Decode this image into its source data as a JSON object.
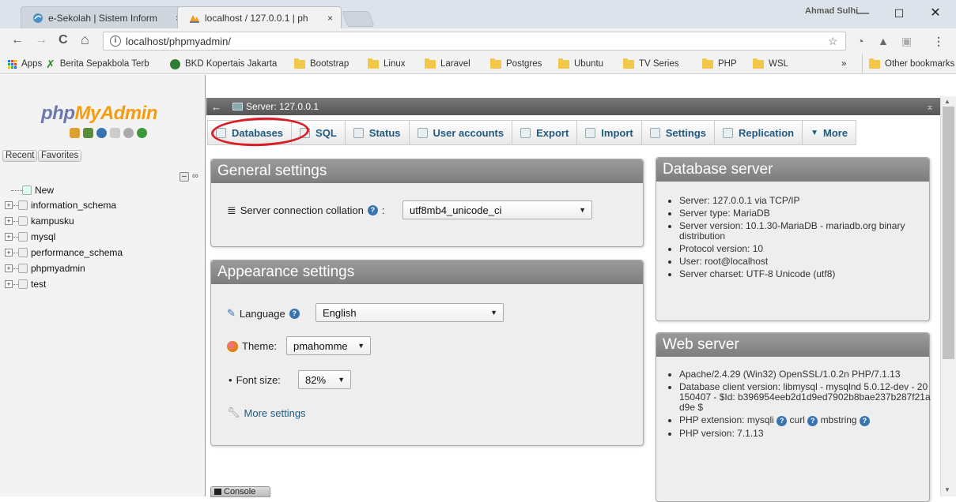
{
  "browser": {
    "tabs": [
      {
        "title": "e-Sekolah | Sistem Inform",
        "close": "×"
      },
      {
        "title": "localhost / 127.0.0.1 | ph",
        "close": "×"
      }
    ],
    "user": "Ahmad Sulhi",
    "window_controls": {
      "minimize": "—",
      "maximize": "☐",
      "close": "✕"
    },
    "url": "localhost/phpmyadmin/",
    "nav": {
      "back": "←",
      "forward": "→",
      "reload": "C",
      "home": "⌂"
    },
    "bookmarks": [
      {
        "label": "Apps",
        "icon": "apps-grid-icon"
      },
      {
        "label": "Berita Sepakbola Terb",
        "icon": "site-icon"
      },
      {
        "label": "BKD Kopertais Jakarta",
        "icon": "site-icon"
      },
      {
        "label": "Bootstrap",
        "icon": "folder-icon"
      },
      {
        "label": "Linux",
        "icon": "folder-icon"
      },
      {
        "label": "Laravel",
        "icon": "folder-icon"
      },
      {
        "label": "Postgres",
        "icon": "folder-icon"
      },
      {
        "label": "Ubuntu",
        "icon": "folder-icon"
      },
      {
        "label": "TV Series",
        "icon": "folder-icon"
      },
      {
        "label": "PHP",
        "icon": "folder-icon"
      },
      {
        "label": "WSL",
        "icon": "folder-icon"
      }
    ],
    "more_bookmarks": "»",
    "other_bookmarks": "Other bookmarks"
  },
  "sidebar": {
    "logo_php": "php",
    "logo_myadmin": "MyAdmin",
    "recent": "Recent",
    "favorites": "Favorites",
    "tree": [
      {
        "label": "New",
        "type": "new"
      },
      {
        "label": "information_schema",
        "type": "db"
      },
      {
        "label": "kampusku",
        "type": "db"
      },
      {
        "label": "mysql",
        "type": "db"
      },
      {
        "label": "performance_schema",
        "type": "db"
      },
      {
        "label": "phpmyadmin",
        "type": "db"
      },
      {
        "label": "test",
        "type": "db"
      }
    ]
  },
  "server_bar": {
    "label": "Server: 127.0.0.1",
    "back": "←",
    "collapse": "⌅"
  },
  "menu": [
    {
      "label": "Databases"
    },
    {
      "label": "SQL"
    },
    {
      "label": "Status"
    },
    {
      "label": "User accounts"
    },
    {
      "label": "Export"
    },
    {
      "label": "Import"
    },
    {
      "label": "Settings"
    },
    {
      "label": "Replication"
    },
    {
      "label": "More",
      "prefix": "▼"
    }
  ],
  "general_settings": {
    "title": "General settings",
    "collation_label": "Server connection collation",
    "collation_colon": ":",
    "collation_value": "utf8mb4_unicode_ci"
  },
  "appearance_settings": {
    "title": "Appearance settings",
    "language_label": "Language",
    "language_value": "English",
    "theme_label": "Theme:",
    "theme_value": "pmahomme",
    "font_size_label": "Font size:",
    "font_size_value": "82%",
    "more_settings": "More settings"
  },
  "database_server": {
    "title": "Database server",
    "items": [
      "Server: 127.0.0.1 via TCP/IP",
      "Server type: MariaDB",
      "Server version: 10.1.30-MariaDB - mariadb.org binary distribution",
      "Protocol version: 10",
      "User: root@localhost",
      "Server charset: UTF-8 Unicode (utf8)"
    ]
  },
  "web_server": {
    "title": "Web server",
    "items": [
      "Apache/2.4.29 (Win32) OpenSSL/1.0.2n PHP/7.1.13",
      "Database client version: libmysql - mysqlnd 5.0.12-dev - 20150407 - $Id: b396954eeb2d1d9ed7902b8bae237b287f21ad9e $"
    ],
    "php_extension_label": "PHP extension: mysqli",
    "php_ext_curl": "curl",
    "php_ext_mbstring": "mbstring",
    "php_version": "PHP version: 7.1.13"
  },
  "console": "Console",
  "colors": {
    "annotation_circle": "#d81f26",
    "logo_php": "#6c78af",
    "logo_myadmin": "#f89c0e",
    "menu_text": "#235a81"
  }
}
